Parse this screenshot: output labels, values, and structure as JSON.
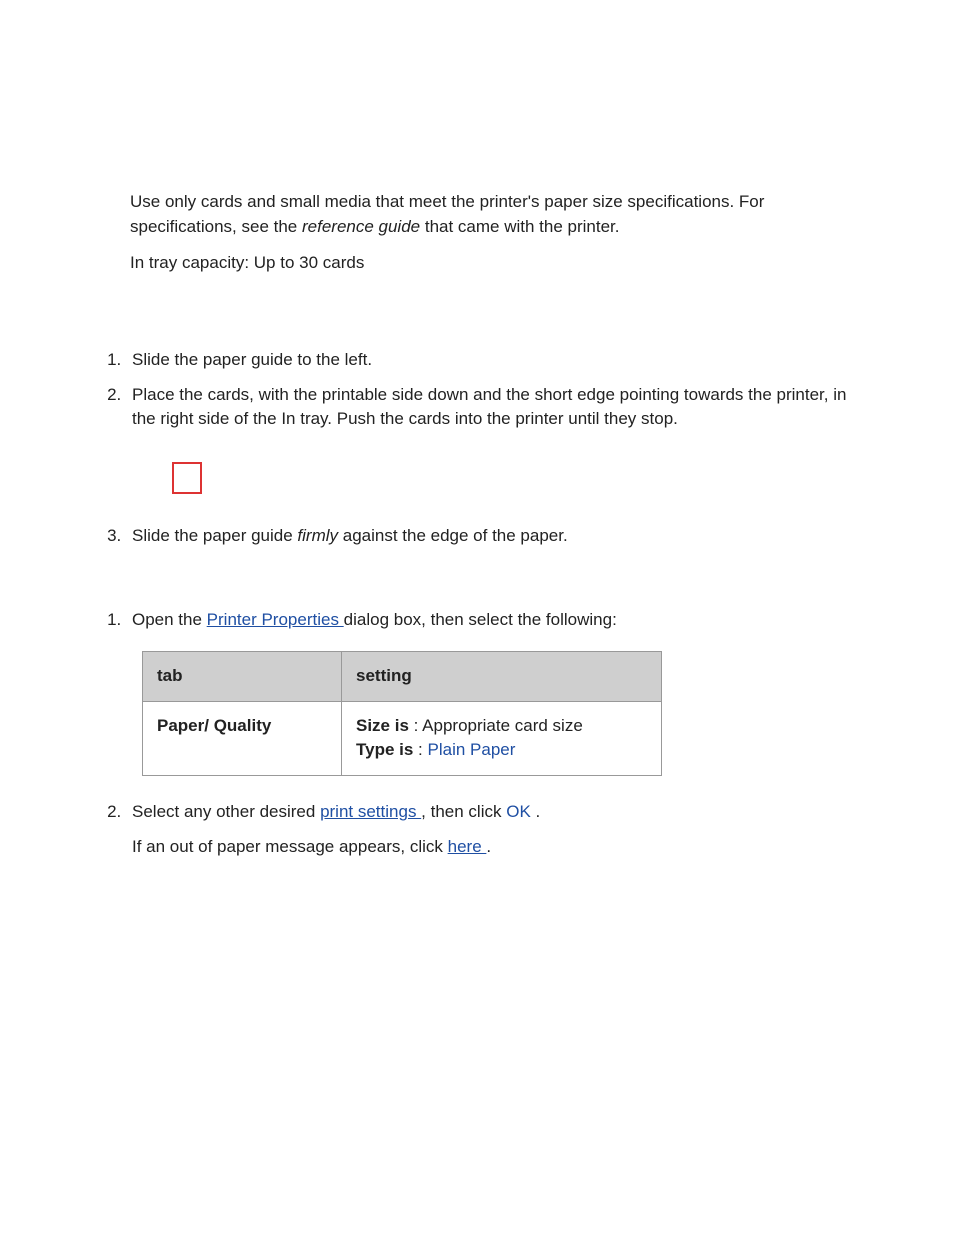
{
  "intro": {
    "p1_a": "Use only cards and small media that meet the printer's paper size specifications. For specifications, see the ",
    "p1_em": "reference guide",
    "p1_b": " that came with the printer.",
    "p2": "In tray capacity: Up to 30 cards"
  },
  "steps_load": {
    "s1": "Slide the paper guide to the left.",
    "s2": "Place the cards, with the printable side down and the short edge pointing towards the printer, in the right side of the In tray. Push the cards into the printer until they stop.",
    "s3_a": "Slide the paper guide ",
    "s3_em": "firmly",
    "s3_b": " against the edge of the paper."
  },
  "steps_print": {
    "s1_a": "Open the ",
    "s1_link": "Printer Properties ",
    "s1_b": "dialog box, then select the following:",
    "table": {
      "h1": "tab",
      "h2": "setting",
      "r1c1": "Paper/ Quality",
      "size_label": "Size is",
      "size_sep": " : ",
      "size_val": "Appropriate card size",
      "type_label": "Type is",
      "type_sep": " : ",
      "type_val": "Plain Paper"
    },
    "s2_a": "Select any other desired ",
    "s2_link": "print settings ",
    "s2_b": ", then click ",
    "s2_ok": "OK",
    "s2_c": " .",
    "s2_p2_a": "If an out of paper message appears, click ",
    "s2_p2_link": "here ",
    "s2_p2_b": "."
  }
}
